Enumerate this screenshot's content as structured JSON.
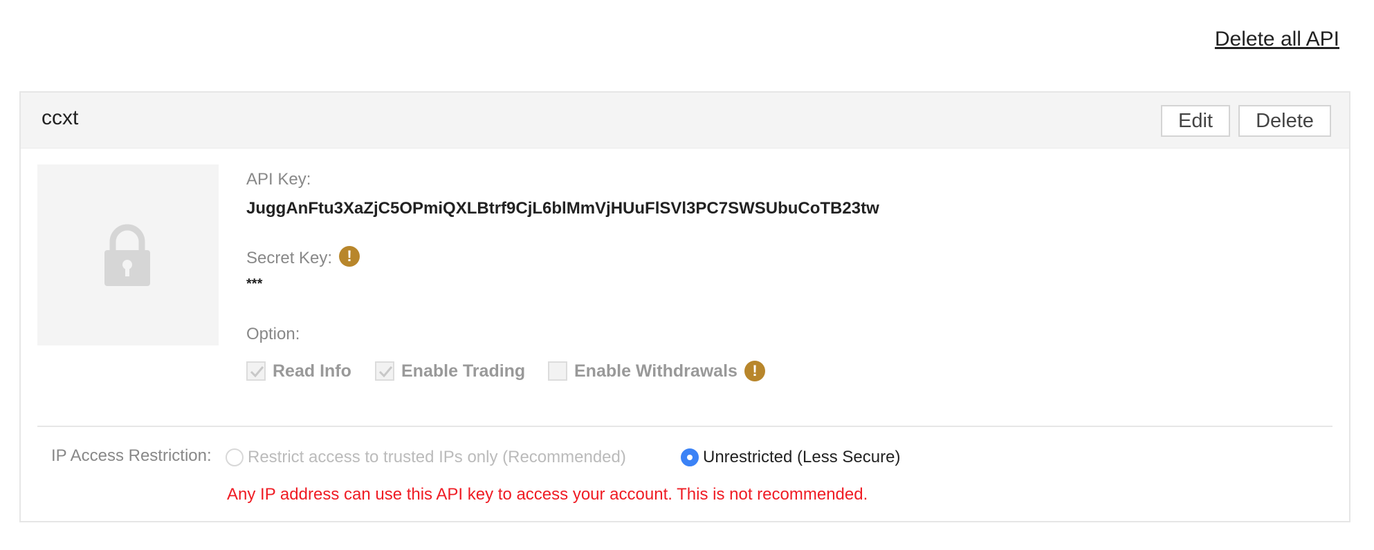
{
  "top": {
    "delete_all_label": "Delete all API"
  },
  "api": {
    "name": "ccxt",
    "edit_label": "Edit",
    "delete_label": "Delete",
    "lock_icon": "lock-icon",
    "api_key_label": "API Key:",
    "api_key_value": "JuggAnFtu3XaZjC5OPmiQXLBtrf9CjL6blMmVjHUuFlSVl3PC7SWSUbuCoTB23tw",
    "secret_key_label": "Secret Key:",
    "secret_key_value": "***",
    "warning_icon": "!",
    "option_label": "Option:",
    "options": [
      {
        "label": "Read Info",
        "checked": true
      },
      {
        "label": "Enable Trading",
        "checked": true
      },
      {
        "label": "Enable Withdrawals",
        "checked": false
      }
    ],
    "ip_restriction": {
      "label": "IP Access Restriction:",
      "choices": [
        {
          "label": "Restrict access to trusted IPs only (Recommended)",
          "selected": false
        },
        {
          "label": "Unrestricted (Less Secure)",
          "selected": true
        }
      ],
      "warning": "Any IP address can use this API key to access your account. This is not recommended."
    }
  },
  "colors": {
    "warning_icon": "#b8862b",
    "radio_selected": "#3b82f6",
    "warning_text": "#ef1c24",
    "header_bg": "#f4f4f4"
  }
}
